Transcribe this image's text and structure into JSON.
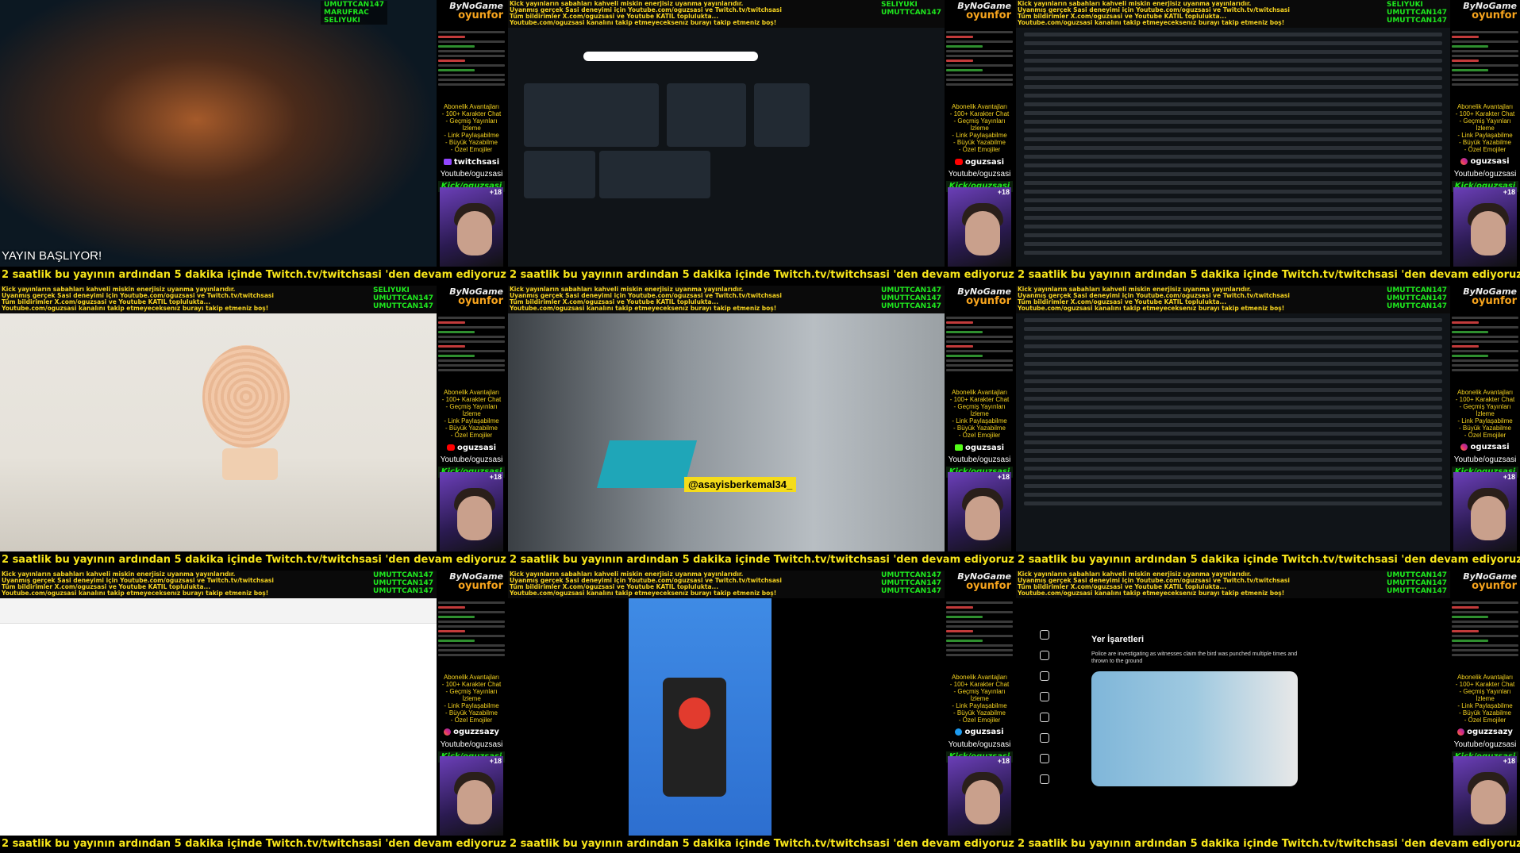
{
  "ticker": "2 saatlik bu yayının ardından 5 dakika içinde Twitch.tv/twitchsasi 'den devam ediyoruz.",
  "info_lines": [
    "Kick yayınların sabahları kahveli miskin enerjisiz uyanma yayınlarıdır.",
    "Uyanmış gerçek Sasi deneyimi için Youtube.com/oguzsasi ve Twitch.tv/twitchsasi",
    "Tüm bildirimler X.com/oguzsasi ve Youtube KATIL topluluktа...",
    "Youtube.com/oguzsasi kanalını takip etmeyeceksenız burayı takip etmeniz boş!"
  ],
  "logo": {
    "line1": "ByNoGame",
    "line2": "oyunfor"
  },
  "perks": [
    "Abonelik Avantajları",
    "- 100+ Karakter Chat",
    "- Geçmiş Yayınları İzleme",
    "- Link Paylaşabilme",
    "- Büyük Yazabilme",
    "- Özel Emojiler"
  ],
  "platform_text": "Youtube/oguzsasi",
  "kick_text": "Kick/oguzsasi",
  "age": "+18",
  "live_text": "YAYIN BAŞLIYOR!",
  "tag_text": "@asayisberkemal34_",
  "tiles": [
    {
      "names": [
        "UMUTTCAN147",
        "MARUFRAC",
        "SELIYUKI"
      ],
      "social": {
        "handle": "twitchsasi",
        "icon": "twitch"
      }
    },
    {
      "names": [
        "SELIYUKI",
        "UMUTTCAN147"
      ],
      "social": {
        "handle": "oguzsasi",
        "icon": "yt"
      }
    },
    {
      "names": [
        "SELIYUKI",
        "UMUTTCAN147",
        "UMUTTCAN147"
      ],
      "social": {
        "handle": "oguzsasi",
        "icon": "ig"
      }
    },
    {
      "names": [
        "SELIYUKI",
        "UMUTTCAN147",
        "UMUTTCAN147"
      ],
      "social": {
        "handle": "oguzsasi",
        "icon": "yt"
      }
    },
    {
      "names": [
        "UMUTTCAN147",
        "UMUTTCAN147",
        "UMUTTCAN147"
      ],
      "social": {
        "handle": "oguzsasi",
        "icon": "kickk"
      }
    },
    {
      "names": [
        "UMUTTCAN147",
        "UMUTTCAN147",
        "UMUTTCAN147"
      ],
      "social": {
        "handle": "oguzsasi",
        "icon": "ig"
      }
    },
    {
      "names": [
        "UMUTTCAN147",
        "UMUTTCAN147",
        "UMUTTCAN147"
      ],
      "social": {
        "handle": "oguzzsazy",
        "icon": "ig"
      }
    },
    {
      "names": [
        "UMUTTCAN147",
        "UMUTTCAN147",
        "UMUTTCAN147"
      ],
      "social": {
        "handle": "oguzsasi",
        "icon": "x"
      }
    },
    {
      "names": [
        "UMUTTCAN147",
        "UMUTTCAN147",
        "UMUTTCAN147"
      ],
      "social": {
        "handle": "oguzzsazy",
        "icon": "ig"
      }
    }
  ],
  "x_post": {
    "header": "Yer İşaretleri",
    "text": "Police are investigating as witnesses claim the bird was punched multiple times and thrown to the ground"
  }
}
